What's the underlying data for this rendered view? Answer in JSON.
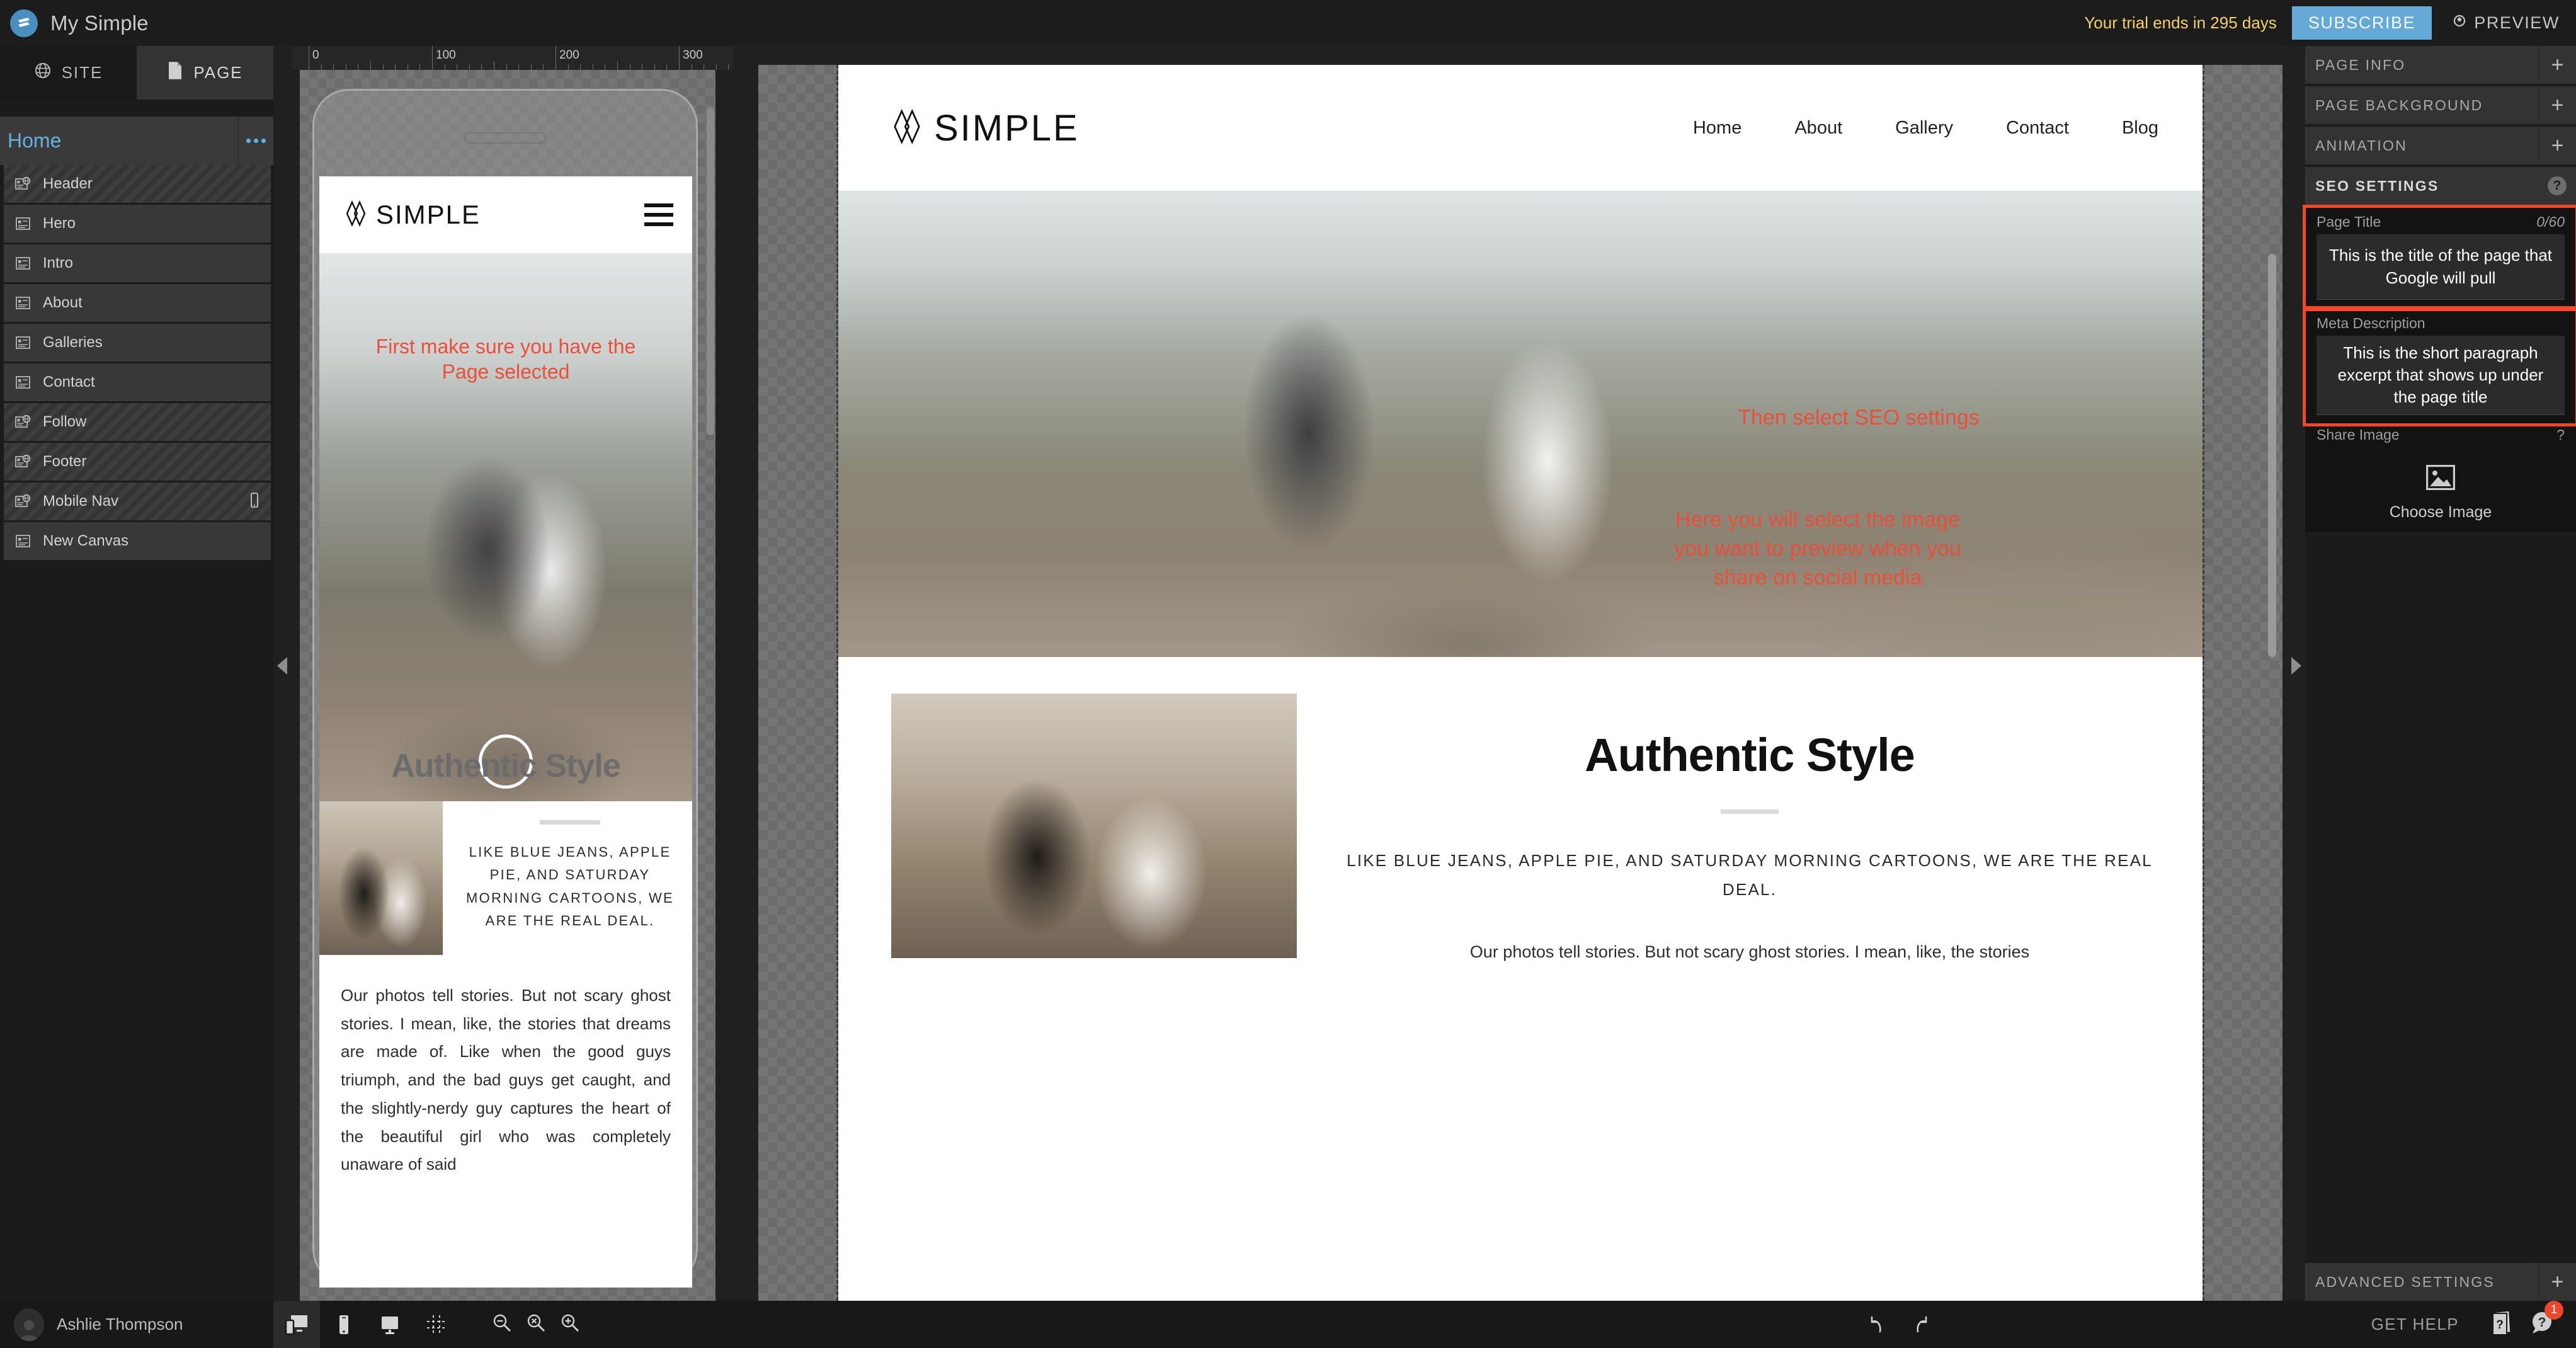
{
  "topbar": {
    "app_title": "My Simple",
    "logo_icon": "simple-logo-icon",
    "trial_text": "Your trial ends in 295 days",
    "subscribe_label": "SUBSCRIBE",
    "preview_label": "PREVIEW",
    "preview_icon": "eye-icon",
    "accent_blue": "#65aad6",
    "trial_yellow": "#f2d06b"
  },
  "sidebar": {
    "tabs": [
      {
        "label": "SITE",
        "icon": "globe-icon",
        "active": false
      },
      {
        "label": "PAGE",
        "icon": "document-icon",
        "active": true
      }
    ],
    "page_name": "Home",
    "page_menu_icon": "kebab-dots-icon",
    "layers": [
      {
        "label": "Header",
        "icon": "global-section-icon",
        "striped": true,
        "mobile": false
      },
      {
        "label": "Hero",
        "icon": "canvas-section-icon",
        "striped": false,
        "mobile": false
      },
      {
        "label": "Intro",
        "icon": "canvas-section-icon",
        "striped": false,
        "mobile": false
      },
      {
        "label": "About",
        "icon": "canvas-section-icon",
        "striped": false,
        "mobile": false
      },
      {
        "label": "Galleries",
        "icon": "canvas-section-icon",
        "striped": false,
        "mobile": false
      },
      {
        "label": "Contact",
        "icon": "canvas-section-icon",
        "striped": false,
        "mobile": false
      },
      {
        "label": "Follow",
        "icon": "global-section-icon",
        "striped": true,
        "mobile": false
      },
      {
        "label": "Footer",
        "icon": "global-section-icon",
        "striped": true,
        "mobile": false
      },
      {
        "label": "Mobile Nav",
        "icon": "global-section-icon",
        "striped": true,
        "mobile": true
      },
      {
        "label": "New Canvas",
        "icon": "canvas-section-icon",
        "striped": false,
        "mobile": false
      }
    ]
  },
  "canvas": {
    "ruler_labels": [
      "0",
      "100",
      "200",
      "300"
    ],
    "mobile": {
      "logo_text": "SIMPLE",
      "menu_icon": "hamburger-icon",
      "annotation": "First make sure\nyou have the Page\nselected",
      "ghost_heading": "Authentic Style",
      "tagline": "LIKE BLUE JEANS, APPLE PIE, AND SATURDAY MORNING CARTOONS, WE ARE THE REAL DEAL.",
      "body": "Our photos tell stories. But not scary ghost stories. I mean, like, the stories that dreams are made of. Like when the good guys triumph, and the bad guys get caught, and the slightly-nerdy guy captures the heart of the beautiful girl who was completely unaware of said"
    },
    "desktop": {
      "logo_text": "SIMPLE",
      "nav": [
        "Home",
        "About",
        "Gallery",
        "Contact",
        "Blog"
      ],
      "annotation_seo": "Then select SEO settings",
      "annotation_image": "Here you will select the image\nyou want to preview when you\nshare on social media",
      "heading": "Authentic Style",
      "tagline": "LIKE BLUE JEANS, APPLE PIE, AND SATURDAY MORNING CARTOONS, WE ARE THE REAL DEAL.",
      "body": "Our photos tell stories. But not scary ghost stories. I mean, like, the stories"
    },
    "annotation_color": "#e8503a"
  },
  "rightpanel": {
    "sections": [
      {
        "label": "PAGE INFO",
        "open": false
      },
      {
        "label": "PAGE BACKGROUND",
        "open": false
      },
      {
        "label": "ANIMATION",
        "open": false
      }
    ],
    "seo": {
      "label": "SEO SETTINGS",
      "help_icon": "question-circle-icon",
      "page_title": {
        "label": "Page Title",
        "count": "0/60",
        "value": "This is the title of the page that Google will pull"
      },
      "meta_description": {
        "label": "Meta Description",
        "value": "This is the short paragraph excerpt that shows up under the page title"
      },
      "share_image": {
        "label": "Share Image",
        "help": "?",
        "icon": "image-placeholder-icon",
        "button_label": "Choose Image"
      }
    },
    "advanced": {
      "label": "ADVANCED SETTINGS",
      "open": false
    },
    "highlight_color": "#f0462a"
  },
  "bottombar": {
    "user_name": "Ashlie Thompson",
    "avatar_icon": "user-avatar-icon",
    "view_tools": [
      {
        "name": "responsive-view-icon",
        "active": true
      },
      {
        "name": "mobile-view-icon",
        "active": false
      },
      {
        "name": "desktop-view-icon",
        "active": false
      },
      {
        "name": "grid-guides-icon",
        "active": false
      }
    ],
    "zoom_tools": [
      {
        "name": "zoom-out-icon"
      },
      {
        "name": "zoom-reset-icon"
      },
      {
        "name": "zoom-in-icon"
      }
    ],
    "undo_icon": "undo-icon",
    "redo_icon": "redo-icon",
    "get_help_label": "GET HELP",
    "help_doc_icon": "help-doc-icon",
    "help_chat_icon": "help-chat-icon",
    "help_badge_count": "1"
  }
}
